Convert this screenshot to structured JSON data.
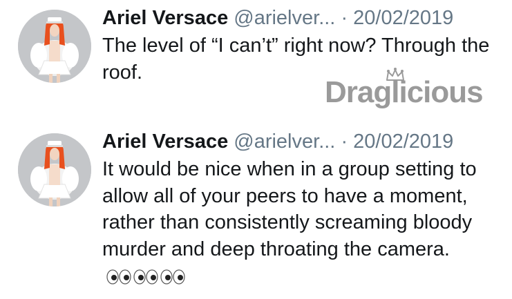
{
  "tweets": [
    {
      "name": "Ariel Versace",
      "handle": "@arielver...",
      "separator": "·",
      "date": "20/02/2019",
      "text": "The level of “I can’t” right now? Through the roof."
    },
    {
      "name": "Ariel Versace",
      "handle": "@arielver...",
      "separator": "·",
      "date": "20/02/2019",
      "text": "It would be nice when in a group setting to allow all of your peers to have a moment, rather than consistently screaming bloody murder and deep throating the camera.",
      "emoji": [
        "eyes-icon",
        "eyes-icon",
        "eyes-icon"
      ]
    }
  ],
  "watermark": {
    "text": "Draglicious",
    "icon": "crown-icon"
  },
  "colors": {
    "name": "#14171a",
    "meta": "#657786",
    "watermark": "#9a9a9a",
    "avatar_bg": "#c7c9cc",
    "hair": "#e8501e"
  }
}
